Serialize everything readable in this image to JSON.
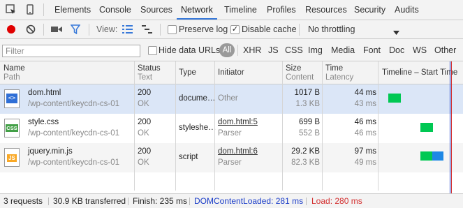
{
  "tabs": {
    "items": [
      {
        "label": "Elements"
      },
      {
        "label": "Console"
      },
      {
        "label": "Sources"
      },
      {
        "label": "Network"
      },
      {
        "label": "Timeline"
      },
      {
        "label": "Profiles"
      },
      {
        "label": "Resources"
      },
      {
        "label": "Security"
      },
      {
        "label": "Audits"
      }
    ],
    "active": "Network"
  },
  "toolbar": {
    "view_label": "View:",
    "preserve_log_label": "Preserve log",
    "preserve_log_checked": false,
    "disable_cache_label": "Disable cache",
    "disable_cache_checked": true,
    "throttling": "No throttling"
  },
  "filter": {
    "placeholder": "Filter",
    "hide_data_urls_label": "Hide data URLs",
    "types": [
      "All",
      "XHR",
      "JS",
      "CSS",
      "Img",
      "Media",
      "Font",
      "Doc",
      "WS",
      "Other"
    ],
    "active_type": "All"
  },
  "columns": {
    "name": "Name",
    "name_sub": "Path",
    "status": "Status",
    "status_sub": "Text",
    "type": "Type",
    "initiator": "Initiator",
    "size": "Size",
    "size_sub": "Content",
    "time": "Time",
    "time_sub": "Latency",
    "timeline": "Timeline – Start Time"
  },
  "requests": [
    {
      "name": "dom.html",
      "path": "/wp-content/keycdn-cs-01",
      "status": "200",
      "status_text": "OK",
      "type": "docume…",
      "initiator": "Other",
      "initiator_detail": "",
      "size": "1017 B",
      "content": "1.3 KB",
      "time": "44 ms",
      "latency": "43 ms",
      "icon": "html-file-icon",
      "icon_label": "<>"
    },
    {
      "name": "style.css",
      "path": "/wp-content/keycdn-cs-01",
      "status": "200",
      "status_text": "OK",
      "type": "styleshe…",
      "initiator": "dom.html:5",
      "initiator_detail": "Parser",
      "size": "699 B",
      "content": "552 B",
      "time": "46 ms",
      "latency": "46 ms",
      "icon": "css-file-icon",
      "icon_label": "CSS"
    },
    {
      "name": "jquery.min.js",
      "path": "/wp-content/keycdn-cs-01",
      "status": "200",
      "status_text": "OK",
      "type": "script",
      "initiator": "dom.html:6",
      "initiator_detail": "Parser",
      "size": "29.2 KB",
      "content": "82.3 KB",
      "time": "97 ms",
      "latency": "49 ms",
      "icon": "js-file-icon",
      "icon_label": "JS"
    }
  ],
  "status": {
    "requests": "3 requests",
    "transferred": "30.9 KB transferred",
    "finish": "Finish: 235 ms",
    "dom_content_loaded": "DOMContentLoaded: 281 ms",
    "load": "Load: 280 ms"
  },
  "colors": {
    "accent": "#3879d9",
    "record": "#e00000",
    "waiting": "#00c853",
    "download": "#1e88e5",
    "dom_content_loaded": "#1a3cc8",
    "load": "#d32f2f",
    "selected_row": "#dbe6f7"
  }
}
